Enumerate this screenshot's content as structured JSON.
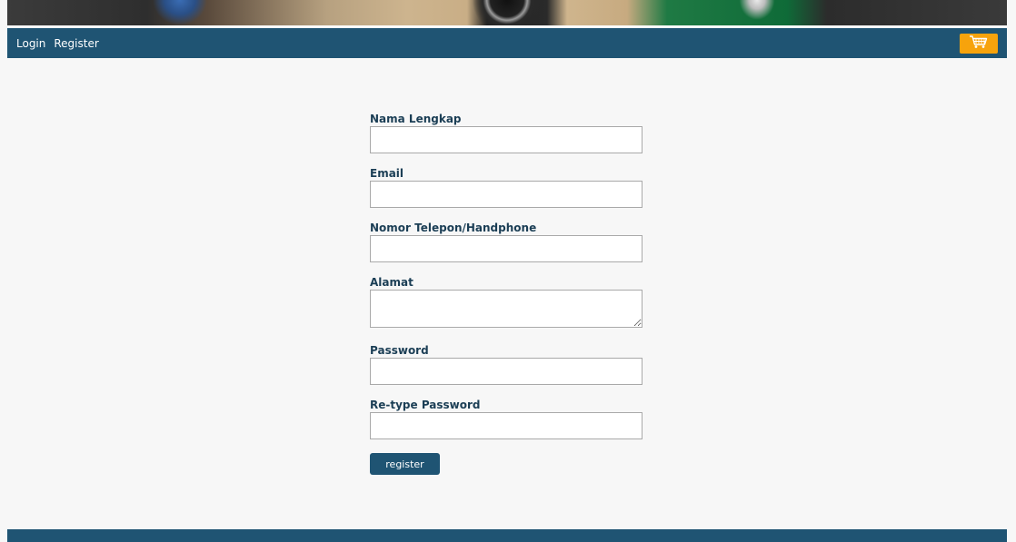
{
  "nav": {
    "login_label": "Login",
    "register_label": "Register",
    "cart_icon": "shopping-cart-icon",
    "accent_color": "#f7a30c",
    "bar_color": "#1f5473"
  },
  "form": {
    "full_name_label": "Nama Lengkap",
    "email_label": "Email",
    "phone_label": "Nomor Telepon/Handphone",
    "address_label": "Alamat",
    "password_label": "Password",
    "retype_password_label": "Re-type Password",
    "submit_label": "register"
  }
}
